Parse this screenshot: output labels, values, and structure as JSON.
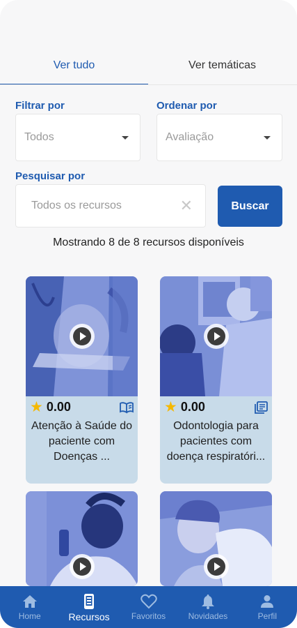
{
  "tabs": [
    {
      "label": "Ver tudo",
      "active": true
    },
    {
      "label": "Ver temáticas",
      "active": false
    }
  ],
  "filters": {
    "filter_label": "Filtrar por",
    "filter_value": "Todos",
    "order_label": "Ordenar por",
    "order_value": "Avaliação"
  },
  "search": {
    "label": "Pesquisar por",
    "placeholder": "Todos os recursos",
    "button_label": "Buscar"
  },
  "results_text": "Mostrando 8 de 8 recursos disponíveis",
  "cards": [
    {
      "rating": "0.00",
      "title": "Atenção à Saúde do paciente com Doenças ...",
      "type_icon": "book-icon"
    },
    {
      "rating": "0.00",
      "title": "Odontologia para pacientes com doença respiratóri...",
      "type_icon": "library-icon"
    },
    {
      "rating": "",
      "title": "",
      "type_icon": ""
    },
    {
      "rating": "",
      "title": "",
      "type_icon": ""
    }
  ],
  "nav": [
    {
      "label": "Home",
      "icon": "home-icon",
      "active": false
    },
    {
      "label": "Recursos",
      "icon": "phone-icon",
      "active": true
    },
    {
      "label": "Favoritos",
      "icon": "heart-icon",
      "active": false
    },
    {
      "label": "Novidades",
      "icon": "bell-icon",
      "active": false
    },
    {
      "label": "Perfil",
      "icon": "person-icon",
      "active": false
    }
  ],
  "colors": {
    "primary": "#1f5bb0",
    "card_bg": "#c8dbe9",
    "star": "#f5b800"
  }
}
